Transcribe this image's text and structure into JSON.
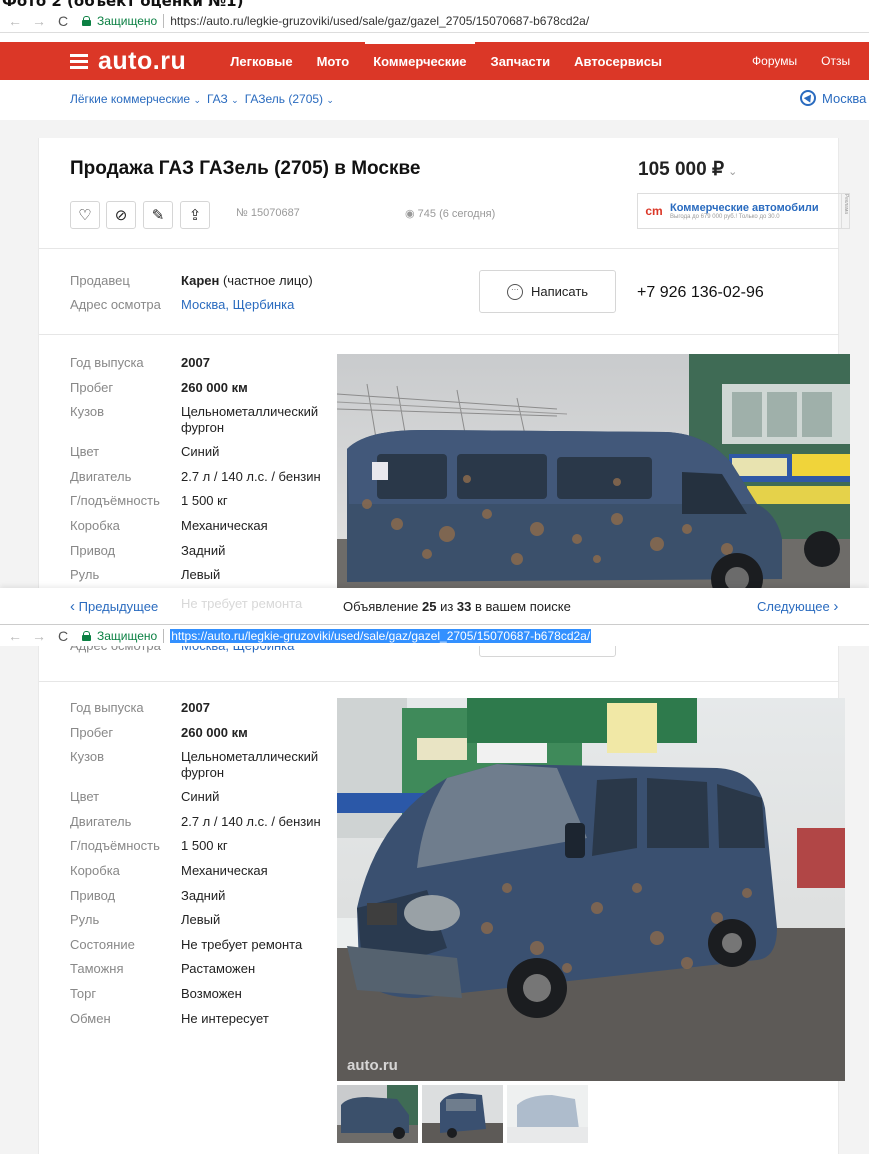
{
  "caption": "Фото 2 (объект оценки №1)",
  "browser": {
    "secure_label": "Защищено",
    "url": "https://auto.ru/legkie-gruzoviki/used/sale/gaz/gazel_2705/15070687-b678cd2a/"
  },
  "header": {
    "logo": "auto.ru",
    "nav": [
      "Легковые",
      "Мото",
      "Коммерческие",
      "Запчасти",
      "Автосервисы"
    ],
    "forums": "Форумы",
    "reviews": "Отзы"
  },
  "breadcrumbs": [
    "Лёгкие коммерческие",
    "ГАЗ",
    "ГАЗель (2705)"
  ],
  "city": "Москва",
  "listing": {
    "title": "Продажа ГАЗ ГАЗель (2705) в Москве",
    "price": "105 000 ₽",
    "ad_number": "№ 15070687",
    "views": "745 (6 сегодня)"
  },
  "promo": {
    "title": "Коммерческие автомобили",
    "sub": "Выгода до 679 000 руб.! Только до 30.0",
    "ad_tag": "Реклама"
  },
  "seller": {
    "label": "Продавец",
    "name": "Карен",
    "type": " (частное лицо)",
    "address_label": "Адрес осмотра",
    "address": "Москва, Щербинка",
    "write_button": "Написать",
    "phone": "+7 926 136-02-96"
  },
  "specs": [
    {
      "label": "Год выпуска",
      "value": "2007"
    },
    {
      "label": "Пробег",
      "value": "260 000 км"
    },
    {
      "label": "Кузов",
      "value": "Цельнометаллический",
      "value2": "фургон"
    },
    {
      "label": "Цвет",
      "value": "Синий"
    },
    {
      "label": "Двигатель",
      "value": "2.7 л / 140 л.с. / бензин"
    },
    {
      "label": "Г/подъёмность",
      "value": "1 500 кг"
    },
    {
      "label": "Коробка",
      "value": "Механическая"
    },
    {
      "label": "Привод",
      "value": "Задний"
    },
    {
      "label": "Руль",
      "value": "Левый"
    },
    {
      "label": "Состояние",
      "value": "Не требует ремонта"
    },
    {
      "label": "Таможня",
      "value": "Растаможен"
    },
    {
      "label": "Торг",
      "value": "Возможен"
    },
    {
      "label": "Обмен",
      "value": "Не интересует"
    }
  ],
  "paginator": {
    "prev": "Предыдущее",
    "text_pre": "Объявление ",
    "current": "25",
    "text_mid": " из ",
    "total": "33",
    "text_post": " в вашем поиске",
    "next": "Следующее"
  },
  "watermark": "auto.ru",
  "icons": [
    "heart-icon",
    "block-icon",
    "edit-icon",
    "share-icon",
    "eye-icon",
    "chat-icon",
    "geo-icon"
  ],
  "colors": {
    "brand_red": "#db3727",
    "link": "#2a6bbf",
    "secure": "#0b8043",
    "van": "#3a4f6a"
  }
}
